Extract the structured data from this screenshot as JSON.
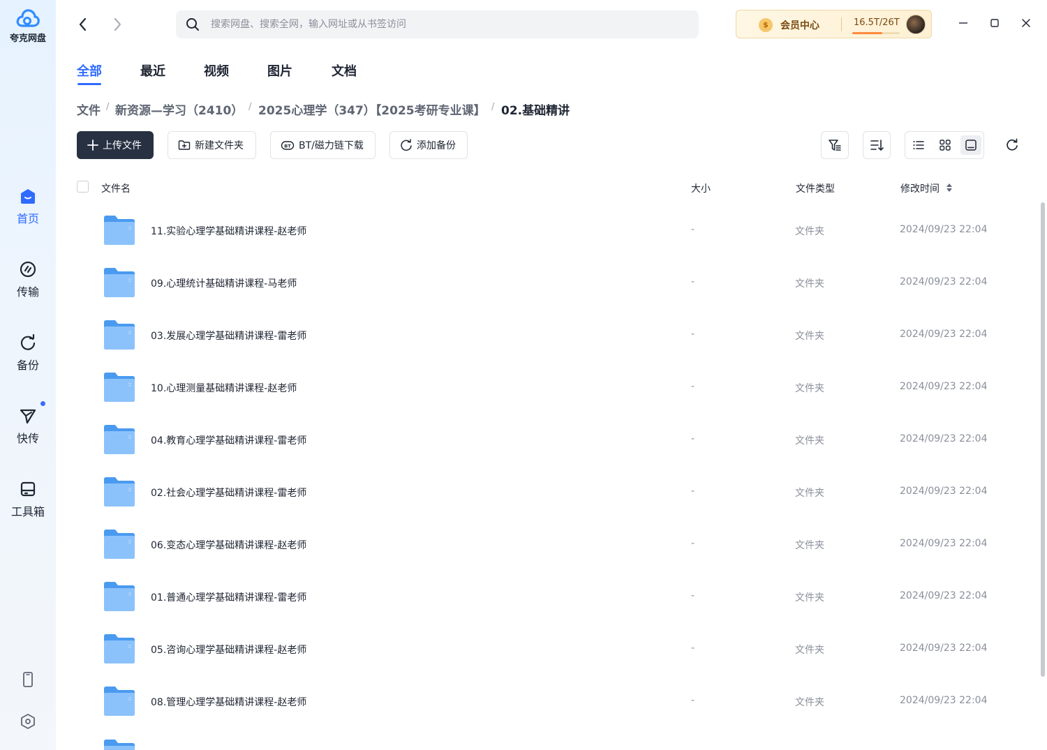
{
  "app": {
    "name": "夸克网盘",
    "accent": "#2f6bff"
  },
  "sidebar": {
    "items": [
      {
        "label": "首页",
        "icon": "home-icon",
        "active": true
      },
      {
        "label": "传输",
        "icon": "transfer-icon",
        "active": false
      },
      {
        "label": "备份",
        "icon": "backup-icon",
        "active": false
      },
      {
        "label": "快传",
        "icon": "quick-send-icon",
        "active": false,
        "badge_dot": true
      },
      {
        "label": "工具箱",
        "icon": "toolbox-icon",
        "active": false
      }
    ],
    "bottom_icons": [
      "phone-icon",
      "settings-icon"
    ]
  },
  "search": {
    "placeholder": "搜索网盘、搜索全网，输入网址或从书签访问"
  },
  "vip": {
    "label": "会员中心",
    "coin_symbol": "$",
    "storage": "16.5T/26T",
    "storage_used_fraction": 0.635
  },
  "tabs": [
    {
      "label": "全部",
      "active": true
    },
    {
      "label": "最近",
      "active": false
    },
    {
      "label": "视频",
      "active": false
    },
    {
      "label": "图片",
      "active": false
    },
    {
      "label": "文档",
      "active": false
    }
  ],
  "breadcrumb": {
    "items": [
      "文件",
      "新资源—学习（2410）",
      "2025心理学（347）【2025考研专业课】",
      "02.基础精讲"
    ],
    "separator": "/"
  },
  "toolbar": {
    "upload": "上传文件",
    "new_folder": "新建文件夹",
    "bt_download": "BT/磁力链下载",
    "add_backup": "添加备份"
  },
  "table": {
    "columns": {
      "name": "文件名",
      "size": "大小",
      "type": "文件类型",
      "modified": "修改时间"
    },
    "rows": [
      {
        "name": "11.实验心理学基础精讲课程-赵老师",
        "size": "-",
        "type": "文件夹",
        "modified": "2024/09/23 22:04"
      },
      {
        "name": "09.心理统计基础精讲课程-马老师",
        "size": "-",
        "type": "文件夹",
        "modified": "2024/09/23 22:04"
      },
      {
        "name": "03.发展心理学基础精讲课程-雷老师",
        "size": "-",
        "type": "文件夹",
        "modified": "2024/09/23 22:04"
      },
      {
        "name": "10.心理测量基础精讲课程-赵老师",
        "size": "-",
        "type": "文件夹",
        "modified": "2024/09/23 22:04"
      },
      {
        "name": "04.教育心理学基础精讲课程-雷老师",
        "size": "-",
        "type": "文件夹",
        "modified": "2024/09/23 22:04"
      },
      {
        "name": "02.社会心理学基础精讲课程-雷老师",
        "size": "-",
        "type": "文件夹",
        "modified": "2024/09/23 22:04"
      },
      {
        "name": "06.变态心理学基础精讲课程-赵老师",
        "size": "-",
        "type": "文件夹",
        "modified": "2024/09/23 22:04"
      },
      {
        "name": "01.普通心理学基础精讲课程-雷老师",
        "size": "-",
        "type": "文件夹",
        "modified": "2024/09/23 22:04"
      },
      {
        "name": "05.咨询心理学基础精讲课程-赵老师",
        "size": "-",
        "type": "文件夹",
        "modified": "2024/09/23 22:04"
      },
      {
        "name": "08.管理心理学基础精讲课程-赵老师",
        "size": "-",
        "type": "文件夹",
        "modified": "2024/09/23 22:04"
      }
    ]
  }
}
